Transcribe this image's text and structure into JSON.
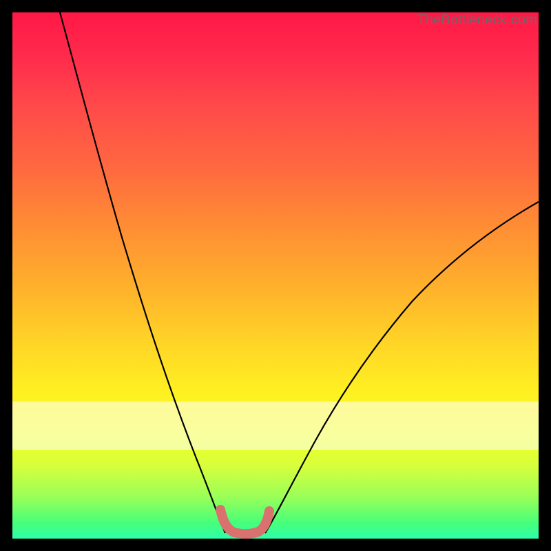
{
  "watermark": "TheBottleneck.com",
  "colors": {
    "frame": "#000000",
    "watermark_text": "#6a6a6a",
    "curve_stroke": "#000000",
    "trough_stroke": "#d9716e",
    "gradient_stops": [
      "#ff1846",
      "#ff2a4c",
      "#ff4a4a",
      "#ff6a3f",
      "#ff8b35",
      "#ffb02c",
      "#ffd227",
      "#fff022",
      "#f2ff28",
      "#d8ff3a",
      "#9bff58",
      "#47ff7a",
      "#2effa9"
    ]
  },
  "chart_data": {
    "type": "line",
    "title": "",
    "xlabel": "",
    "ylabel": "",
    "xlim": [
      0,
      100
    ],
    "ylim": [
      0,
      100
    ],
    "note": "Axes are unlabeled in the source image; x/y are normalized 0–100. y=0 is the bottom green band, y=100 is the top red band.",
    "series": [
      {
        "name": "left-curve",
        "x": [
          9,
          12,
          15,
          18,
          22,
          26,
          30,
          34,
          37,
          39,
          40.5
        ],
        "y": [
          100,
          88,
          76,
          64,
          51,
          38,
          27,
          16,
          8,
          3,
          1
        ]
      },
      {
        "name": "right-curve",
        "x": [
          48,
          50,
          54,
          59,
          65,
          72,
          80,
          88,
          96,
          100
        ],
        "y": [
          1,
          3,
          7,
          13,
          20,
          29,
          39,
          49,
          59,
          64
        ]
      },
      {
        "name": "trough-highlight",
        "x": [
          39.5,
          40.2,
          41.5,
          43.5,
          45.5,
          47.0,
          48.0,
          48.7
        ],
        "y": [
          5.5,
          2.8,
          1.3,
          0.9,
          1.0,
          1.6,
          3.0,
          5.2
        ]
      }
    ],
    "whitish_band_y_range": [
      17,
      26
    ]
  }
}
